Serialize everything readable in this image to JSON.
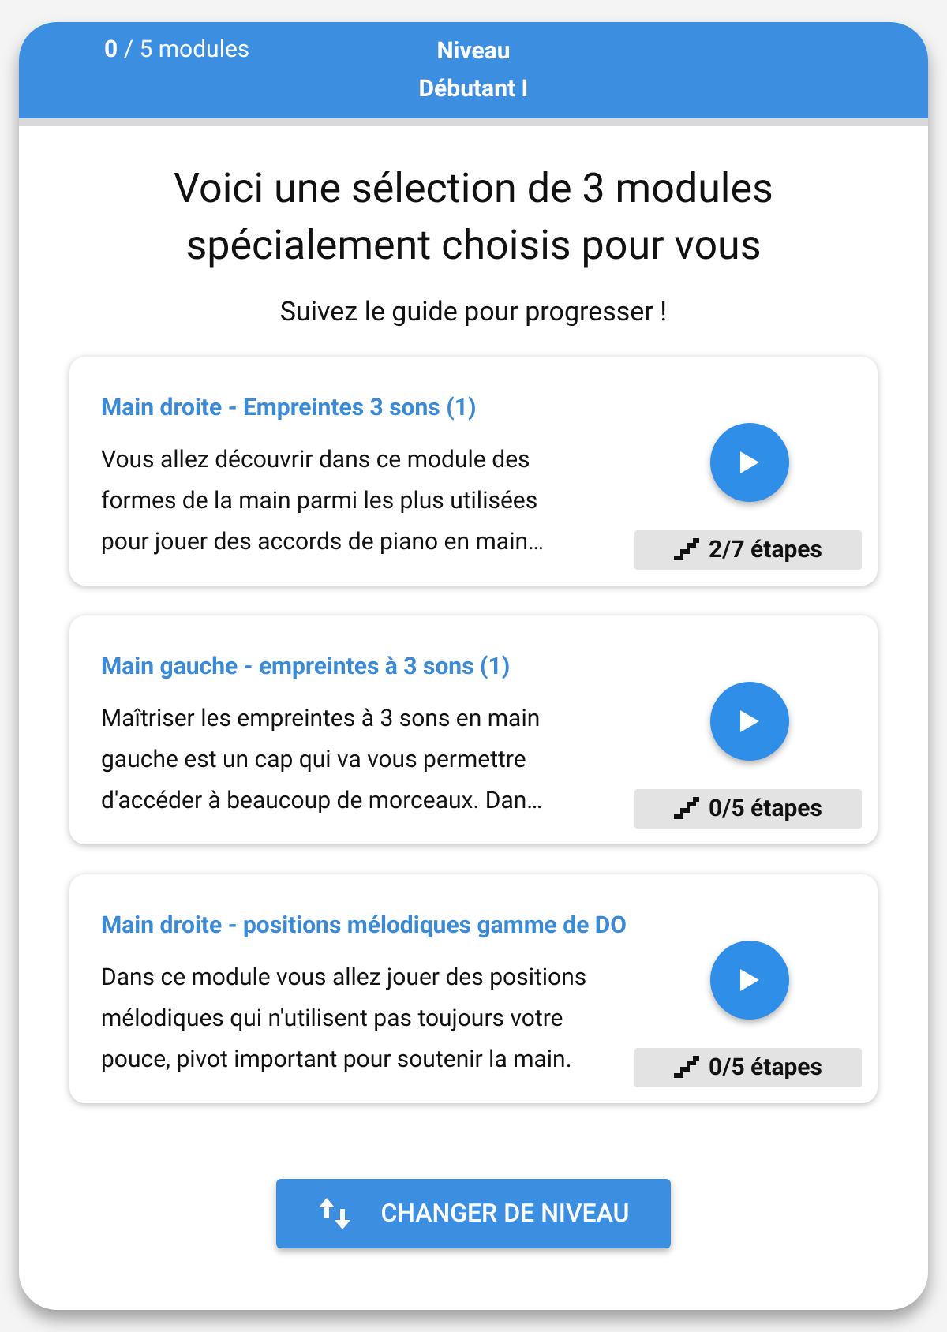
{
  "header": {
    "progress": "**0** / 5 modules",
    "level_label": "Niveau",
    "level_name": "Débutant I"
  },
  "title": "Voici une sélection de 3 modules spécialement choisis pour vous",
  "subtitle": "Suivez le guide pour progresser !",
  "modules": [
    {
      "title": "Main droite - Empreintes 3 sons (1)",
      "description": [
        "Vous allez découvrir dans ce module des",
        "formes de la main parmi les plus utilisées",
        "pour jouer des accords de piano en main…"
      ],
      "steps": "2/7 étapes"
    },
    {
      "title": "Main gauche - empreintes à 3 sons (1)",
      "description": [
        "Maîtriser les empreintes à 3 sons en main",
        "gauche est un cap qui va vous permettre",
        "d'accéder à beaucoup de morceaux. Dan…"
      ],
      "steps": "0/5 étapes"
    },
    {
      "title": "Main droite - positions mélodiques gamme de DO",
      "description": [
        "Dans ce module vous allez jouer des positions",
        "mélodiques qui n'utilisent pas toujours votre",
        "pouce, pivot important pour soutenir la main."
      ],
      "steps": "0/5 étapes"
    }
  ],
  "button": "CHANGER DE NIVEAU"
}
